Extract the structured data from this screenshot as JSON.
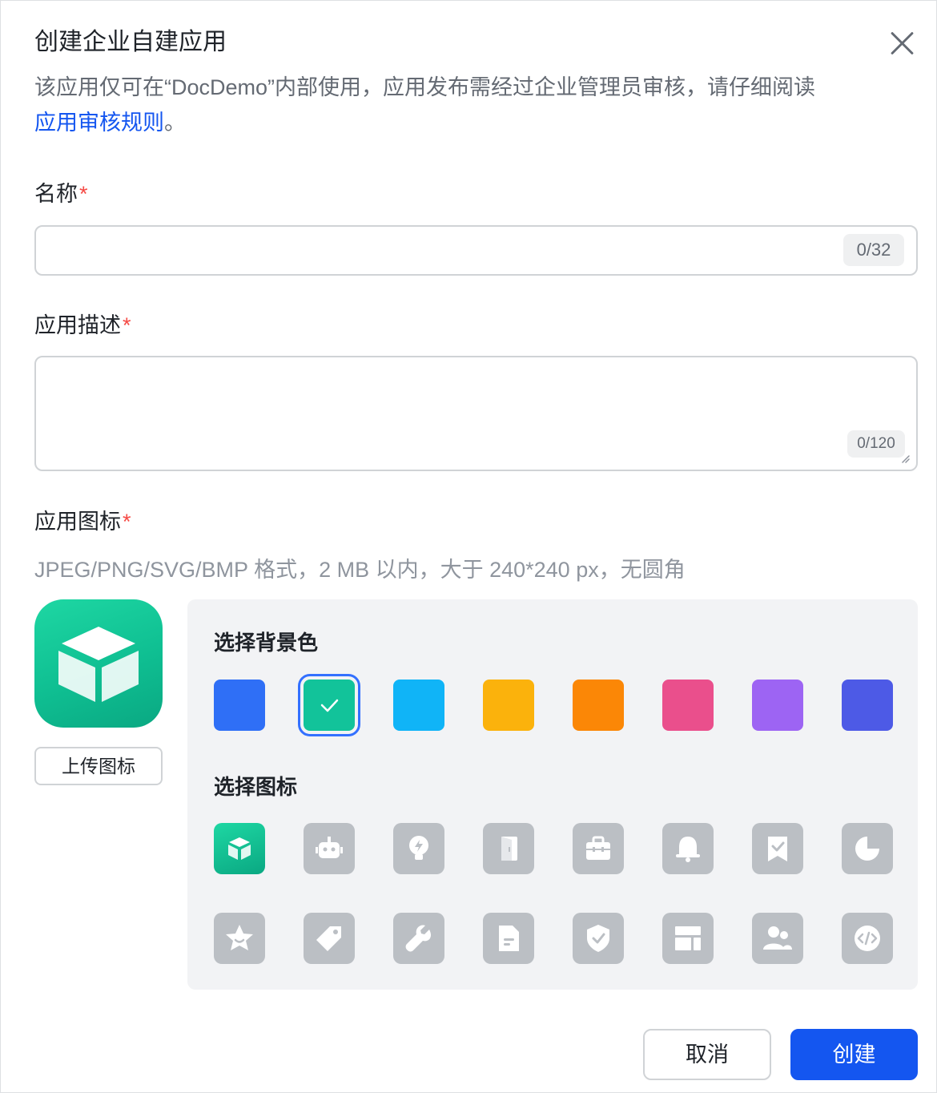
{
  "dialog": {
    "title": "创建企业自建应用",
    "desc_text": "该应用仅可在“DocDemo”内部使用，应用发布需经过企业管理员审核，请仔细阅读",
    "desc_link": "应用审核规则",
    "desc_end": "。"
  },
  "name_field": {
    "label": "名称",
    "required_mark": "*",
    "value": "",
    "counter": "0/32"
  },
  "desc_field": {
    "label": "应用描述",
    "required_mark": "*",
    "value": "",
    "counter": "0/120"
  },
  "icon_field": {
    "label": "应用图标",
    "required_mark": "*",
    "hint": "JPEG/PNG/SVG/BMP 格式，2 MB 以内，大于 240*240 px，无圆角",
    "upload_label": "上传图标"
  },
  "picker": {
    "bg_heading": "选择背景色",
    "icon_heading": "选择图标",
    "colors": [
      "#2f6ff6",
      "#12c39a",
      "#10b4f7",
      "#fbb20c",
      "#fb8706",
      "#ea4f8c",
      "#9d64f3",
      "#4d5ae6"
    ],
    "selected_color_index": 1,
    "icons": [
      "cube-icon",
      "robot-icon",
      "lightbulb-icon",
      "door-icon",
      "briefcase-icon",
      "bell-icon",
      "bookmark-check-icon",
      "pie-chart-icon",
      "star-icon",
      "tag-icon",
      "wrench-icon",
      "document-icon",
      "shield-check-icon",
      "layout-icon",
      "users-icon",
      "code-icon"
    ],
    "selected_icon_index": 0
  },
  "footer": {
    "cancel_label": "取消",
    "create_label": "创建"
  },
  "colors": {
    "primary": "#1456f0",
    "required": "#f54a45",
    "brand_green": "#12c39a"
  }
}
